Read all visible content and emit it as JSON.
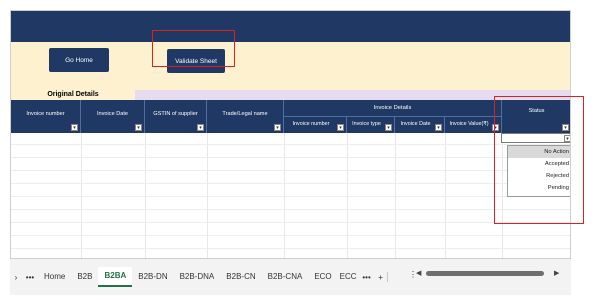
{
  "buttons": {
    "go_home": "Go Home",
    "validate_sheet": "Validate Sheet"
  },
  "sections": {
    "original_details": "Original Details",
    "invoice_details": "Invoice Details"
  },
  "columns": {
    "invoice_number": "Invoice number",
    "invoice_date": "Invoice Date",
    "gstin_supplier": "GSTIN of supplier",
    "trade_legal_name": "Trade/Legal name",
    "invoice_number_sub": "Invoice number",
    "invoice_type": "Invoice type",
    "invoice_date_sub": "Invoice Date",
    "invoice_value": "Invoice Value(₹)",
    "status": "Status"
  },
  "status_dropdown": {
    "options": [
      "No Action",
      "Accepted",
      "Rejected",
      "Pending"
    ],
    "highlighted": "No Action"
  },
  "sheet_tabs": {
    "items": [
      "Home",
      "B2B",
      "B2BA",
      "B2B-DN",
      "B2B-DNA",
      "B2B-CN",
      "B2B-CNA",
      "ECO",
      "ECC"
    ],
    "active": "B2BA",
    "more": "•••",
    "more_right": "•••",
    "add": "+",
    "next": "›",
    "vmore": "⋮"
  },
  "scroll": {
    "left": "◀",
    "right": "▶"
  },
  "colors": {
    "header_navy": "#1f3864",
    "cream": "#fdf1cf",
    "lavender": "#e6dbef",
    "highlight_red": "#e02020",
    "active_tab_green": "#217346"
  }
}
